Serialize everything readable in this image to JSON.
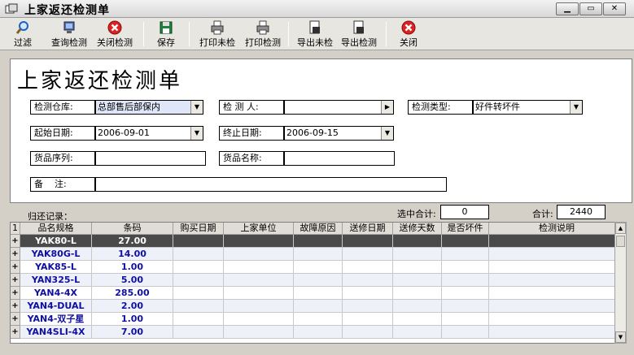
{
  "window": {
    "title": "上家返还检测单",
    "min": "▁",
    "max": "▭",
    "close": "✕"
  },
  "toolbar": {
    "filter": "过滤",
    "query": "查询检测",
    "close_check": "关闭检测",
    "save": "保存",
    "print_unchecked": "打印未检",
    "print_checked": "打印检测",
    "export_unchecked": "导出未检",
    "export_checked": "导出检测",
    "close": "关闭"
  },
  "form": {
    "title": "上家返还检测单",
    "warehouse_label": "检测仓库:",
    "warehouse_value": "总部售后部保内",
    "inspector_label": "检 测 人:",
    "inspector_value": "",
    "type_label": "检测类型:",
    "type_value": "好件转坏件",
    "start_label": "起始日期:",
    "start_value": "2006-09-01",
    "end_label": "终止日期:",
    "end_value": "2006-09-15",
    "serial_label": "货品序列:",
    "serial_value": "",
    "name_label": "货品名称:",
    "name_value": "",
    "remark_label": "备    注:",
    "remark_value": ""
  },
  "summary": {
    "records_label": "归还记录：",
    "selected_label": "选中合计:",
    "selected_value": "0",
    "total_label": "合计:",
    "total_value": "2440"
  },
  "grid": {
    "corner": "1",
    "columns": [
      "品名规格",
      "条码",
      "购买日期",
      "上家单位",
      "故障原因",
      "送修日期",
      "送修天数",
      "是否坏件",
      "检测说明"
    ],
    "rows": [
      {
        "name": "YAK80-L",
        "code": "27.00"
      },
      {
        "name": "YAK80G-L",
        "code": "14.00"
      },
      {
        "name": "YAK85-L",
        "code": "1.00"
      },
      {
        "name": "YAN325-L",
        "code": "5.00"
      },
      {
        "name": "YAN4-4X",
        "code": "285.00"
      },
      {
        "name": "YAN4-DUAL",
        "code": "2.00"
      },
      {
        "name": "YAN4-双子星",
        "code": "1.00"
      },
      {
        "name": "YAN4SLI-4X",
        "code": "7.00"
      }
    ]
  },
  "icons": {
    "filter": "magnifier-icon",
    "query": "monitor-icon",
    "close_check": "red-x-icon",
    "save": "floppy-icon",
    "print": "printer-icon",
    "export": "document-export-icon",
    "close": "red-x-icon"
  },
  "colors": {
    "selected_row": "#4a4a4a",
    "row_text": "#1010a0",
    "selected_field": "#dfe6f7"
  }
}
